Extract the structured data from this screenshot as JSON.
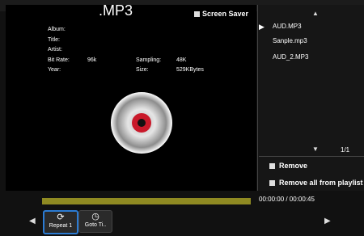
{
  "header": {
    "format": ".MP3",
    "screen_saver_label": "Screen Saver"
  },
  "info": {
    "album_label": "Album:",
    "title_label": "Title:",
    "artist_label": "Artist:",
    "bitrate_label": "Bit Rate:",
    "bitrate_value": "96k",
    "sampling_label": "Sampling:",
    "sampling_value": "48K",
    "year_label": "Year:",
    "size_label": "Size:",
    "size_value": "529KBytes"
  },
  "playlist": {
    "items": [
      "AUD.MP3",
      "Sanple.mp3",
      "AUD_2.MP3"
    ],
    "page_indicator": "1/1",
    "remove_label": "Remove",
    "remove_all_label": "Remove all from playlist"
  },
  "player": {
    "time_label": "00:00:00 / 00:00:45",
    "progress_fraction": 0.0,
    "repeat_label": "Repeat 1",
    "goto_label": "Goto Ti.."
  },
  "colors": {
    "accent": "#2b7bd3",
    "progress": "#a39d2a"
  }
}
